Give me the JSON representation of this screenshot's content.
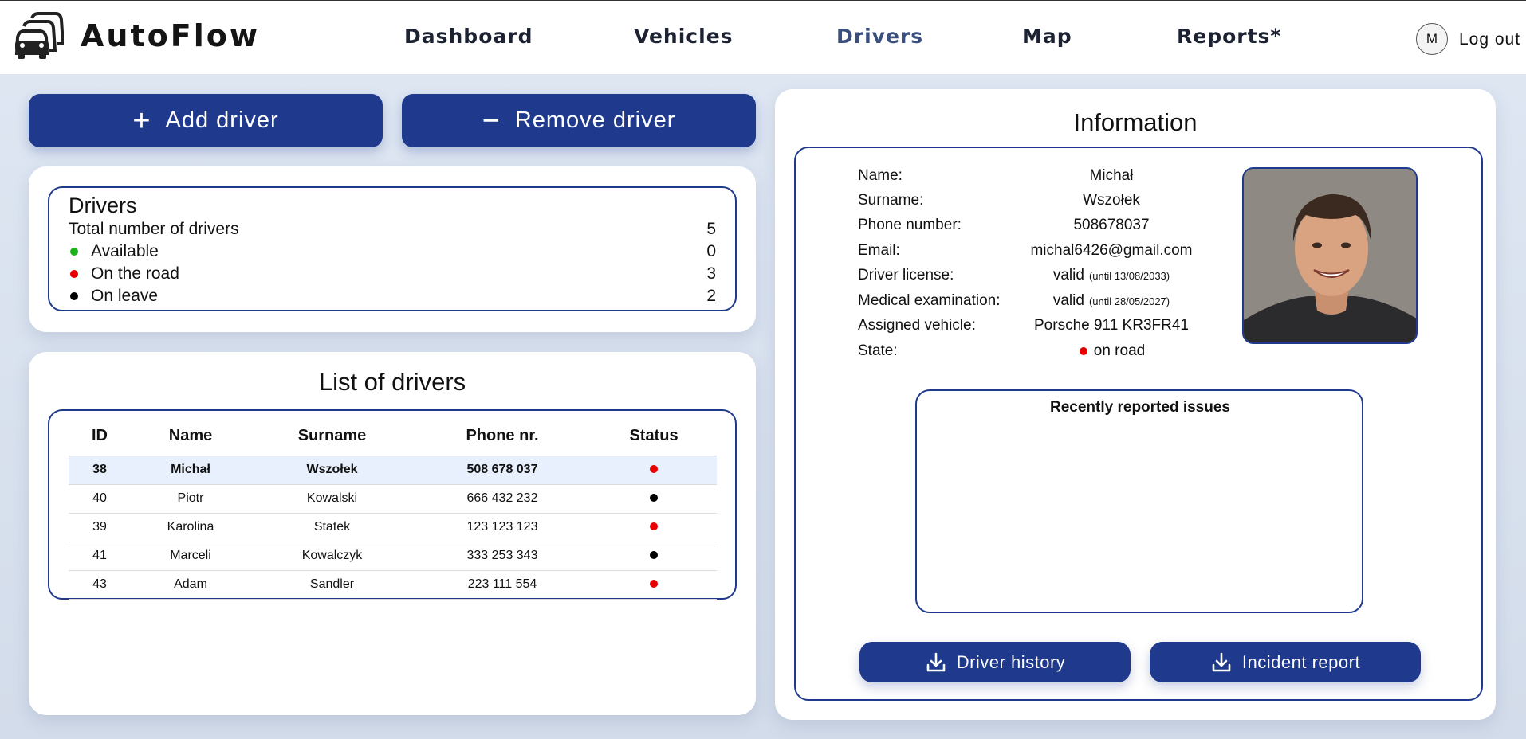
{
  "header": {
    "brand": "AutoFlow",
    "nav": [
      {
        "label": "Dashboard",
        "active": false
      },
      {
        "label": "Vehicles",
        "active": false
      },
      {
        "label": "Drivers",
        "active": true
      },
      {
        "label": "Map",
        "active": false
      },
      {
        "label": "Reports*",
        "active": false
      }
    ],
    "avatar_initial": "M",
    "logout_label": "Log out"
  },
  "actions": {
    "add_icon": "+",
    "add_label": "Add driver",
    "remove_icon": "−",
    "remove_label": "Remove driver"
  },
  "summary": {
    "title": "Drivers",
    "total_label": "Total number of drivers",
    "total_value": "5",
    "available_label": "Available",
    "available_value": "0",
    "road_label": "On the road",
    "road_value": "3",
    "leave_label": "On leave",
    "leave_value": "2"
  },
  "list": {
    "title": "List of drivers",
    "headers": [
      "ID",
      "Name",
      "Surname",
      "Phone nr.",
      "Status"
    ],
    "rows": [
      {
        "id": "38",
        "name": "Michał",
        "surname": "Wszołek",
        "phone": "508 678 037",
        "status": "on-road"
      },
      {
        "id": "40",
        "name": "Piotr",
        "surname": "Kowalski",
        "phone": "666 432 232",
        "status": "on-leave"
      },
      {
        "id": "39",
        "name": "Karolina",
        "surname": "Statek",
        "phone": "123 123 123",
        "status": "on-road"
      },
      {
        "id": "41",
        "name": "Marceli",
        "surname": "Kowalczyk",
        "phone": "333 253 343",
        "status": "on-leave"
      },
      {
        "id": "43",
        "name": "Adam",
        "surname": "Sandler",
        "phone": "223 111 554",
        "status": "on-road"
      }
    ]
  },
  "info": {
    "title": "Information",
    "labels": {
      "name": "Name:",
      "surname": "Surname:",
      "phone": "Phone number:",
      "email": "Email:",
      "license": "Driver license:",
      "medical": "Medical examination:",
      "vehicle": "Assigned vehicle:",
      "state": "State:"
    },
    "values": {
      "name": "Michał",
      "surname": "Wszołek",
      "phone": "508678037",
      "email": "michal6426@gmail.com",
      "license": "valid",
      "license_until": "(until 13/08/2033)",
      "medical": "valid",
      "medical_until": "(until 28/05/2027)",
      "vehicle": "Porsche 911 KR3FR41",
      "state": "on road"
    },
    "issues_title": "Recently reported issues",
    "history_label": "Driver history",
    "incident_label": "Incident report"
  },
  "colors": {
    "accent": "#1f3a8c",
    "available": "#1db31d",
    "on-road": "#e60000",
    "on-leave": "#000000"
  }
}
